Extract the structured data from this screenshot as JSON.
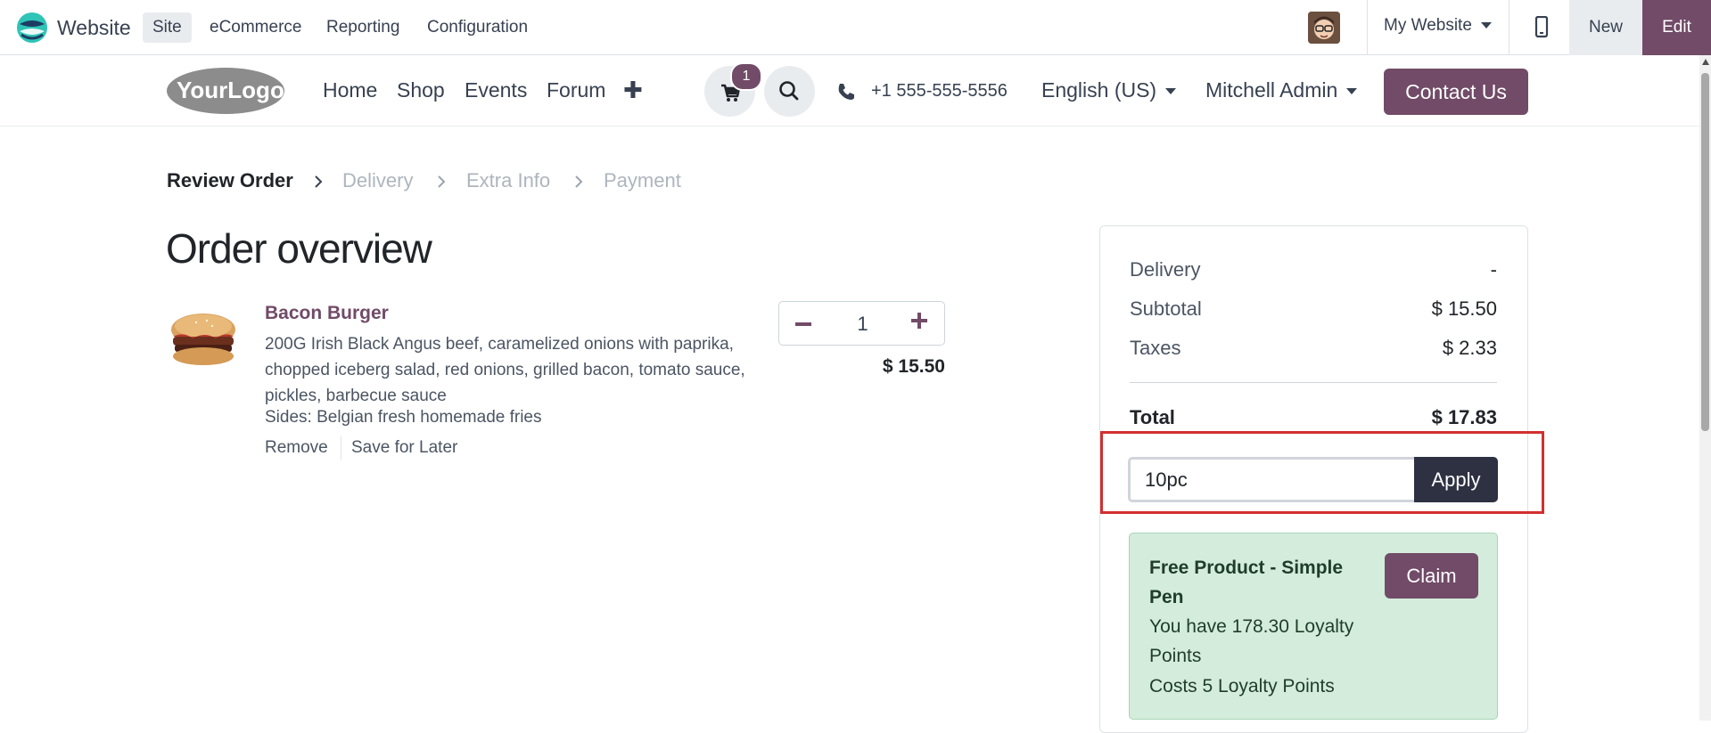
{
  "topbar": {
    "app_name": "Website",
    "menu": [
      "Site",
      "eCommerce",
      "Reporting",
      "Configuration"
    ],
    "website_selector": "My Website",
    "new_label": "New",
    "edit_label": "Edit"
  },
  "header": {
    "logo_text": "YourLogo",
    "nav": [
      "Home",
      "Shop",
      "Events",
      "Forum"
    ],
    "cart_count": "1",
    "phone": "+1 555-555-5556",
    "language": "English (US)",
    "user": "Mitchell Admin",
    "contact_label": "Contact Us"
  },
  "breadcrumb": [
    "Review Order",
    "Delivery",
    "Extra Info",
    "Payment"
  ],
  "page_title": "Order overview",
  "line": {
    "name": "Bacon Burger",
    "description": "200G Irish Black Angus beef, caramelized onions with paprika, chopped iceberg salad, red onions, grilled bacon, tomato sauce, pickles, barbecue sauce",
    "sides": "Sides: Belgian fresh homemade fries",
    "remove_label": "Remove",
    "save_label": "Save for Later",
    "quantity": "1",
    "price": "$ 15.50"
  },
  "summary": {
    "delivery_label": "Delivery",
    "delivery_value": "-",
    "subtotal_label": "Subtotal",
    "subtotal_value": "$ 15.50",
    "taxes_label": "Taxes",
    "taxes_value": "$ 2.33",
    "total_label": "Total",
    "total_value": "$ 17.83",
    "coupon_value": "10pc",
    "apply_label": "Apply"
  },
  "reward": {
    "title": "Free Product - Simple Pen",
    "points_line": "You have 178.30 Loyalty Points",
    "cost_line": "Costs 5 Loyalty Points",
    "claim_label": "Claim"
  },
  "colors": {
    "brand": "#714b67",
    "highlight": "#d32f2f",
    "reward_bg": "#d4ecdc"
  }
}
